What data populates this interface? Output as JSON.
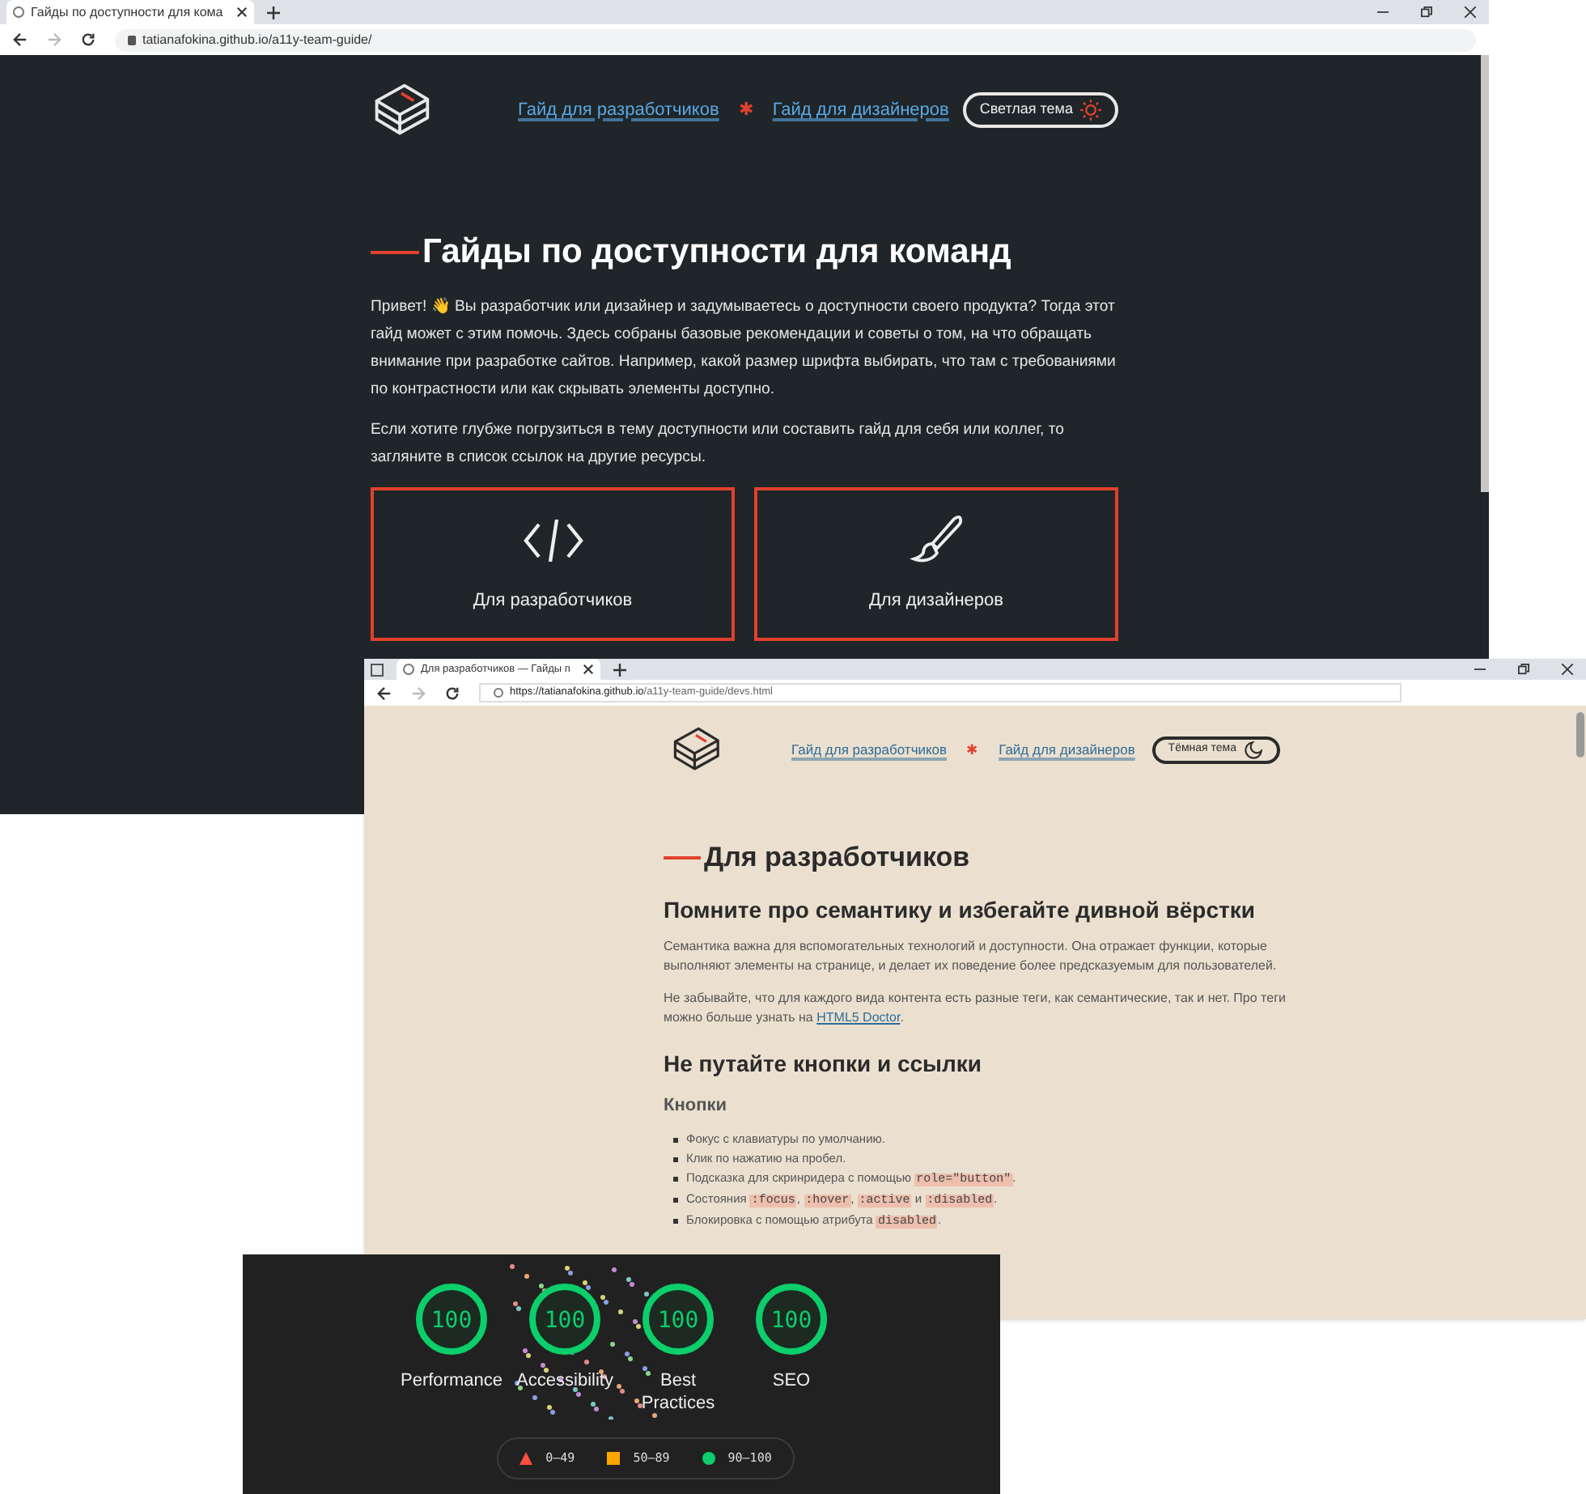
{
  "windows": [
    {
      "kind": "home",
      "tab_title": "Гайды по доступности для кома",
      "url": "tatianafokina.github.io/a11y-team-guide/",
      "nav": [
        {
          "label": "Гайд для разработчиков"
        },
        {
          "label": "Гайд для дизайнеров"
        }
      ],
      "separator": "✱",
      "theme_button": {
        "label": "Светлая тема"
      },
      "heading": "Гайды по доступности для команд",
      "paragraphs": [
        "Привет! 👋 Вы разработчик или дизайнер и задумываетесь о доступности своего продукта? Тогда этот гайд может с этим помочь. Здесь собраны базовые рекомендации и советы о том, на что обращать внимание при разработке сайтов. Например, какой размер шрифта выбирать, что там с требованиями по контрастности или как скрывать элементы доступно.",
        "Если хотите глубже погрузиться в тему доступности или составить гайд для себя или коллег, то загляните в список ссылок на другие ресурсы."
      ],
      "cards": [
        {
          "label": "Для разработчиков"
        },
        {
          "label": "Для дизайнеров"
        }
      ]
    },
    {
      "kind": "devs",
      "tab_title": "Для разработчиков — Гайды п",
      "url_host": "https://tatianafokina.github.io",
      "url_path": "/a11y-team-guide/devs.html",
      "nav": [
        {
          "label": "Гайд для разработчиков"
        },
        {
          "label": "Гайд для дизайнеров"
        }
      ],
      "separator": "✱",
      "theme_button": {
        "label": "Тёмная тема"
      },
      "heading": "Для разработчиков",
      "sections": [
        {
          "kind": "h2",
          "text": "Помните про семантику и избегайте дивной вёрстки"
        },
        {
          "kind": "p",
          "text": "Семантика важна для вспомогательных технологий и доступности. Она отражает функции, которые выполняют элементы на странице, и делает их поведение более предсказуемым для пользователей."
        },
        {
          "kind": "p",
          "text": "Не забывайте, что для каждого вида контента есть разные теги, как семантические, так и нет. Про теги можно больше узнать на",
          "link": "HTML5 Doctor",
          "after": "."
        },
        {
          "kind": "h2",
          "text": "Не путайте кнопки и ссылки"
        },
        {
          "kind": "h3",
          "text": "Кнопки"
        },
        {
          "kind": "list",
          "items": [
            [
              {
                "t": "Фокус с клавиатуры по умолчанию."
              }
            ],
            [
              {
                "t": "Клик по нажатию на пробел."
              }
            ],
            [
              {
                "t": "Подсказка для скринридера с помощью "
              },
              {
                "code": "role=\"button\""
              },
              {
                "t": "."
              }
            ],
            [
              {
                "t": "Состояния "
              },
              {
                "code": ":focus"
              },
              {
                "t": ", "
              },
              {
                "code": ":hover"
              },
              {
                "t": ", "
              },
              {
                "code": ":active"
              },
              {
                "t": " и "
              },
              {
                "code": ":disabled"
              },
              {
                "t": "."
              }
            ],
            [
              {
                "t": "Блокировка с помощью атрибута "
              },
              {
                "code": "disabled"
              },
              {
                "t": "."
              }
            ]
          ]
        }
      ]
    },
    {
      "kind": "lighthouse",
      "scores": [
        {
          "label": "Performance",
          "score": "100",
          "level": 1
        },
        {
          "label": "Accessibility",
          "score": "100",
          "level": 1
        },
        {
          "label": "Best Practices",
          "score": "100",
          "level": 1
        },
        {
          "label": "SEO",
          "score": "100",
          "level": 1
        }
      ],
      "legend": [
        {
          "color": "#ff4e42",
          "label": "0–49"
        },
        {
          "color": "#ffa400",
          "label": "50–89"
        },
        {
          "color": "#0cce6b",
          "label": "90–100"
        }
      ]
    }
  ]
}
